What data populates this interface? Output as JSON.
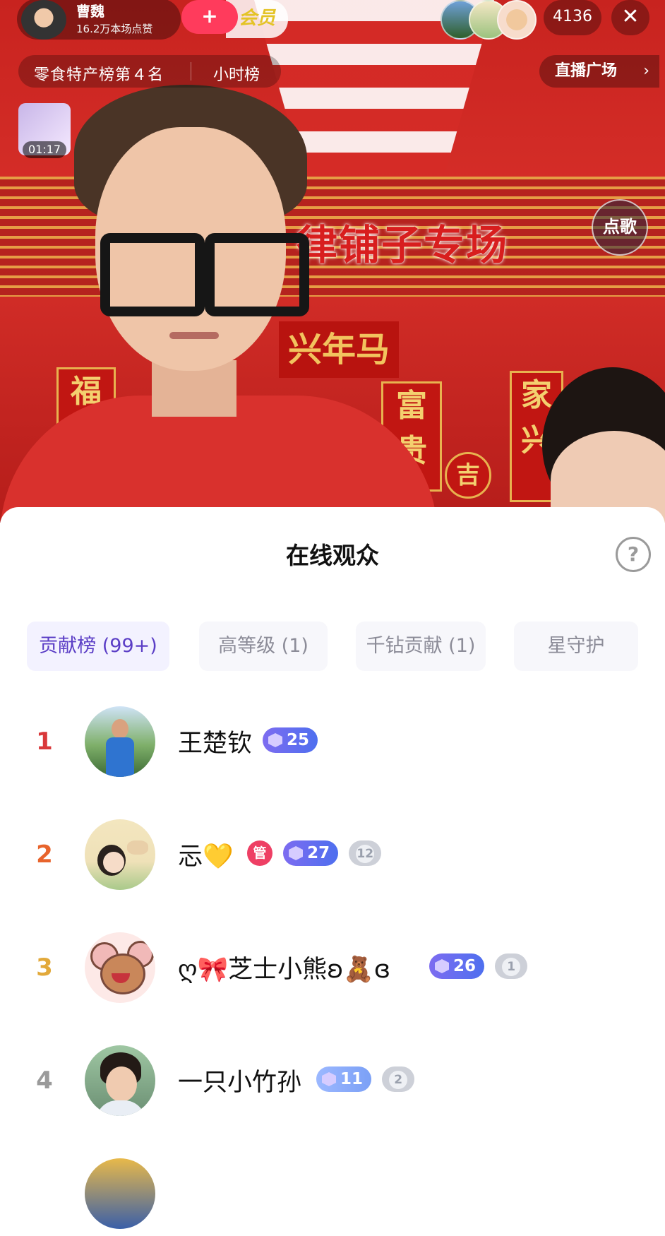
{
  "stream": {
    "host_name": "曹魏",
    "host_likes": "16.2万本场点赞",
    "follow_symbol": "+",
    "member_tag": "会员",
    "online_count": "4136",
    "close_symbol": "✕",
    "rank_label": "零食特产榜第４名",
    "hour_label": "小时榜",
    "plaza_label": "直播广场",
    "plaza_chevron": "›",
    "clip_time": "01:17",
    "song_label": "点歌",
    "banner_text": "律铺子专场",
    "sign_text": "兴年马",
    "couplet_left": "福",
    "couplet_mid": "富贵",
    "couplet_right": "家兴",
    "lantern_text": "吉"
  },
  "sheet": {
    "title": "在线观众",
    "help_symbol": "?",
    "tabs": [
      {
        "label": "贡献榜 (99+)",
        "active": true
      },
      {
        "label": "高等级 (1)",
        "active": false
      },
      {
        "label": "千钻贡献 (1)",
        "active": false
      },
      {
        "label": "星守护",
        "active": false
      }
    ]
  },
  "viewers": [
    {
      "rank": "1",
      "rank_color": "#d9383a",
      "name": "王楚钦",
      "admin": "",
      "level": "25",
      "fan_level": ""
    },
    {
      "rank": "2",
      "rank_color": "#e8642c",
      "name": "忈💛",
      "admin": "管",
      "level": "27",
      "fan_level": "12"
    },
    {
      "rank": "3",
      "rank_color": "#e2a93a",
      "name": "ღ🎀芝士小熊ʚ🧸ɞ",
      "admin": "",
      "level": "26",
      "fan_level": "1"
    },
    {
      "rank": "4",
      "rank_color": "#9a9a9a",
      "name": "一只小竹孙",
      "admin": "",
      "level": "11",
      "fan_level": "2"
    }
  ]
}
